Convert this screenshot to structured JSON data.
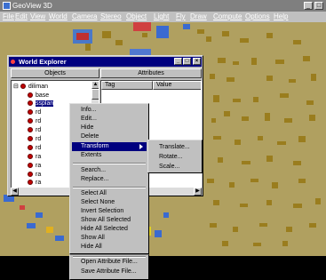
{
  "app": {
    "title": "GeoView 3D"
  },
  "menubar": [
    "File",
    "Edit",
    "View",
    "World",
    "Camera",
    "Stereo",
    "Object",
    "Light",
    "Fly",
    "Draw",
    "Compute",
    "Options",
    "Help"
  ],
  "explorer": {
    "title": "World Explorer",
    "objects_header": "Objects",
    "attributes_header": "Attributes",
    "col_tag": "Tag",
    "col_value": "Value",
    "tree": [
      {
        "label": "diliman",
        "indent": 0,
        "expander": "⊟"
      },
      {
        "label": "base",
        "indent": 1
      },
      {
        "label": "ssplan",
        "indent": 1,
        "selected": true
      },
      {
        "label": "rd",
        "indent": 1
      },
      {
        "label": "rd",
        "indent": 1
      },
      {
        "label": "rd",
        "indent": 1
      },
      {
        "label": "rd",
        "indent": 1
      },
      {
        "label": "rd",
        "indent": 1
      },
      {
        "label": "ra",
        "indent": 1
      },
      {
        "label": "ra",
        "indent": 1
      },
      {
        "label": "ra",
        "indent": 1
      },
      {
        "label": "ra",
        "indent": 1
      }
    ]
  },
  "context_menu": {
    "items": [
      "Info...",
      "Edit...",
      "Hide",
      "Delete",
      "Transform",
      "Extents",
      "Search...",
      "Replace...",
      "Select All",
      "Select None",
      "Invert Selection",
      "Show All Selected",
      "Hide All Selected",
      "Show All",
      "Hide All",
      "Open Attribute File...",
      "Save Attribute File..."
    ],
    "highlighted": "Transform"
  },
  "submenu": {
    "items": [
      "Translate...",
      "Rotate...",
      "Scale..."
    ]
  },
  "colors": {
    "titlebar": "#7f7f7f",
    "active_title": "#00007f",
    "terrain": "#b0a060",
    "building": "#8a6a10"
  }
}
